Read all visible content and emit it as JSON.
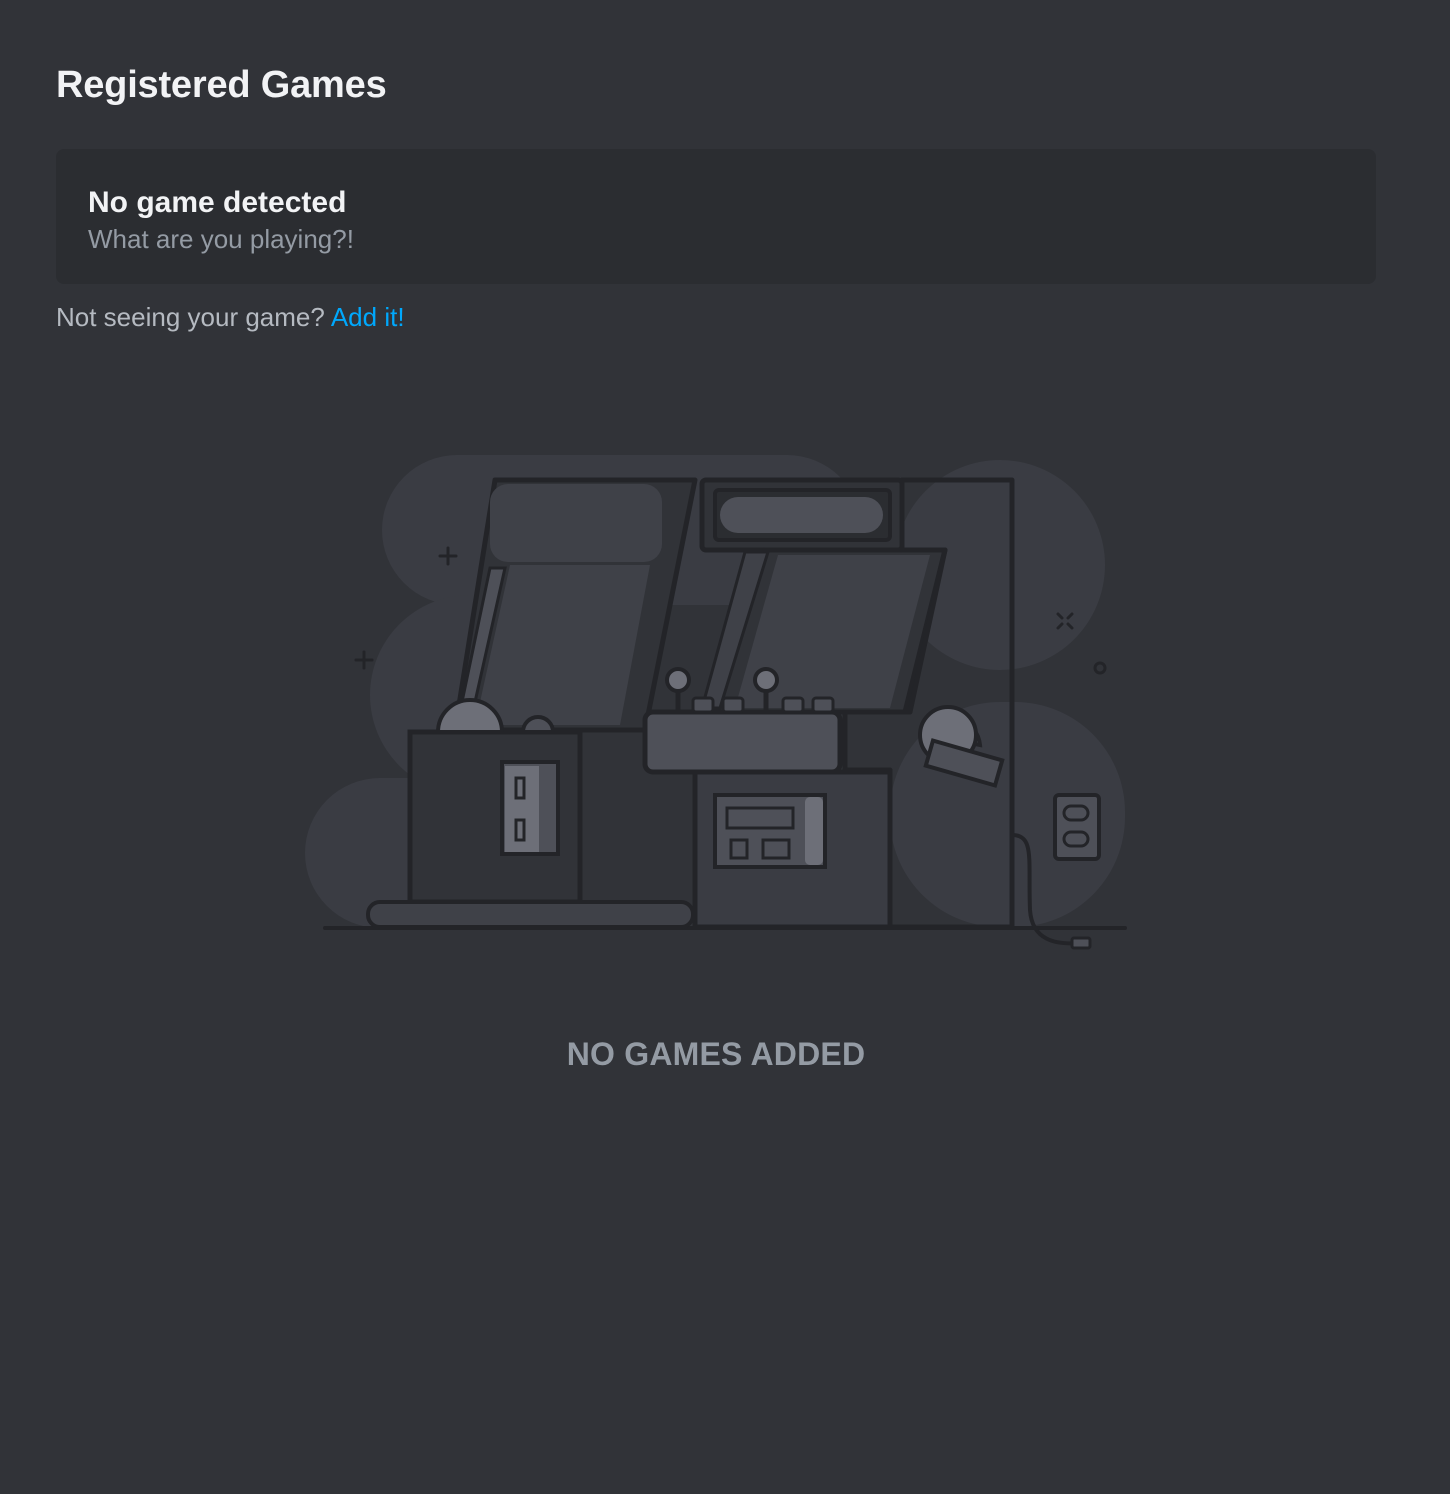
{
  "page": {
    "title": "Registered Games"
  },
  "detection": {
    "title": "No game detected",
    "subtitle": "What are you playing?!"
  },
  "hint": {
    "text": "Not seeing your game?",
    "link_label": "Add it!"
  },
  "empty_state": {
    "illustration_icon": "arcade-machines-illustration",
    "label": "NO GAMES ADDED"
  },
  "colors": {
    "background": "#313338",
    "card": "#2b2d31",
    "link": "#00a8fc",
    "muted_text": "#949ba4",
    "heading_text": "#f2f3f5"
  }
}
